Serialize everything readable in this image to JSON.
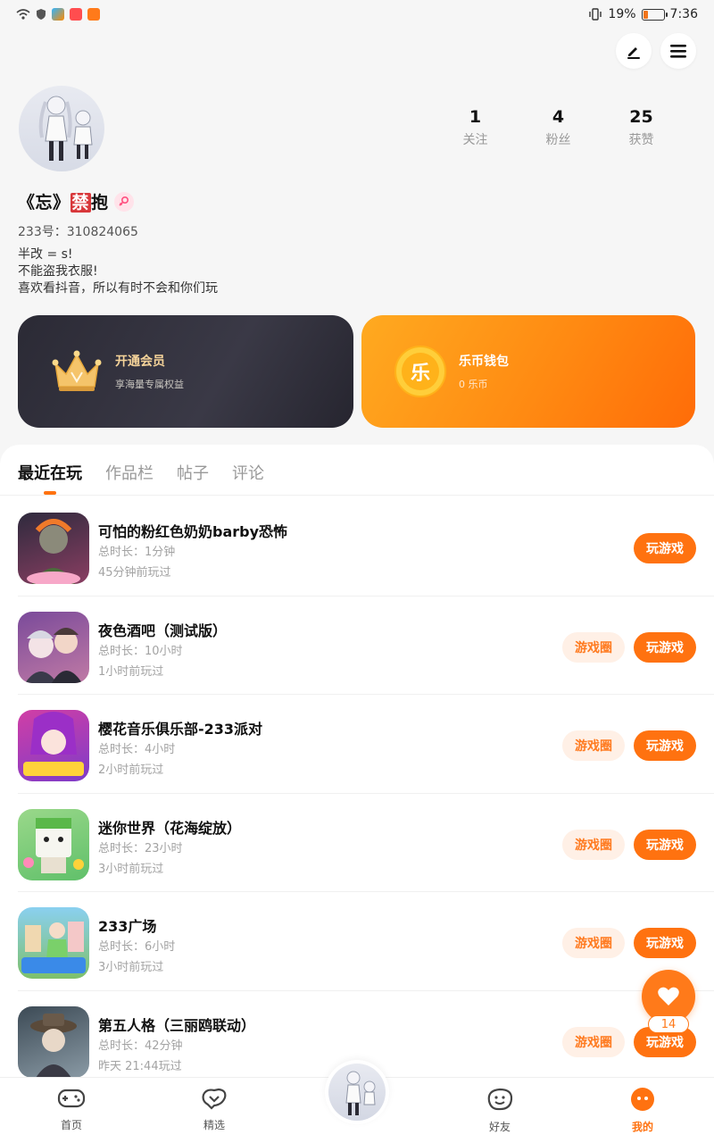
{
  "status_bar": {
    "battery_percent": "19%",
    "time": "7:36",
    "battery_level": 0.19
  },
  "header": {
    "edit_icon": "edit-pen-icon",
    "menu_icon": "hamburger-menu-icon"
  },
  "profile": {
    "stats": [
      {
        "value": "1",
        "label": "关注"
      },
      {
        "value": "4",
        "label": "粉丝"
      },
      {
        "value": "25",
        "label": "获赞"
      }
    ],
    "nickname_prefix": "《忘》",
    "nickname_ban": "禁",
    "nickname_suffix": "抱",
    "uid": "233号：310824065",
    "bio_lines": [
      "半改 = s!",
      "不能盗我衣服!",
      "喜欢看抖音，所以有时不会和你们玩"
    ]
  },
  "cards": {
    "vip": {
      "title": "开通会员",
      "subtitle": "享海量专属权益"
    },
    "wallet": {
      "title": "乐币钱包",
      "subtitle": "0 乐币",
      "coin_char": "乐"
    }
  },
  "tabs": [
    {
      "label": "最近在玩",
      "active": true
    },
    {
      "label": "作品栏",
      "active": false
    },
    {
      "label": "帖子",
      "active": false
    },
    {
      "label": "评论",
      "active": false
    }
  ],
  "games": [
    {
      "name": "可怕的粉红色奶奶barby恐怖",
      "duration": "总时长：1分钟",
      "last_played": "45分钟前玩过",
      "has_circle": false,
      "c1": "#2e2a3d",
      "c2": "#8a3e62"
    },
    {
      "name": "夜色酒吧（测试版）",
      "duration": "总时长：10小时",
      "last_played": "1小时前玩过",
      "has_circle": true,
      "c1": "#5a3c7a",
      "c2": "#c07aa5"
    },
    {
      "name": "樱花音乐俱乐部-233派对",
      "duration": "总时长：4小时",
      "last_played": "2小时前玩过",
      "has_circle": true,
      "c1": "#d13ea5",
      "c2": "#7e3cc9"
    },
    {
      "name": "迷你世界（花海绽放）",
      "duration": "总时长：23小时",
      "last_played": "3小时前玩过",
      "has_circle": true,
      "c1": "#60c06a",
      "c2": "#a8e08a"
    },
    {
      "name": "233广场",
      "duration": "总时长：6小时",
      "last_played": "3小时前玩过",
      "has_circle": true,
      "c1": "#4aa3e8",
      "c2": "#a8d86a"
    },
    {
      "name": "第五人格（三丽鸥联动）",
      "duration": "总时长：42分钟",
      "last_played": "昨天 21:44玩过",
      "has_circle": true,
      "c1": "#3c4a55",
      "c2": "#8a9aa5"
    }
  ],
  "buttons": {
    "play": "玩游戏",
    "circle": "游戏圈"
  },
  "floating": {
    "favorite_count": "14"
  },
  "bottom_nav": [
    {
      "label": "首页",
      "icon": "gamepad-icon",
      "active": false
    },
    {
      "label": "精选",
      "icon": "heart-chat-icon",
      "active": false
    },
    {
      "label": "好友",
      "icon": "smile-face-icon",
      "active": false
    },
    {
      "label": "我的",
      "icon": "profile-face-icon",
      "active": true
    }
  ],
  "colors": {
    "accent": "#ff7210",
    "vip_card": "#2b2a35",
    "wallet_card": "#ff8a12"
  }
}
